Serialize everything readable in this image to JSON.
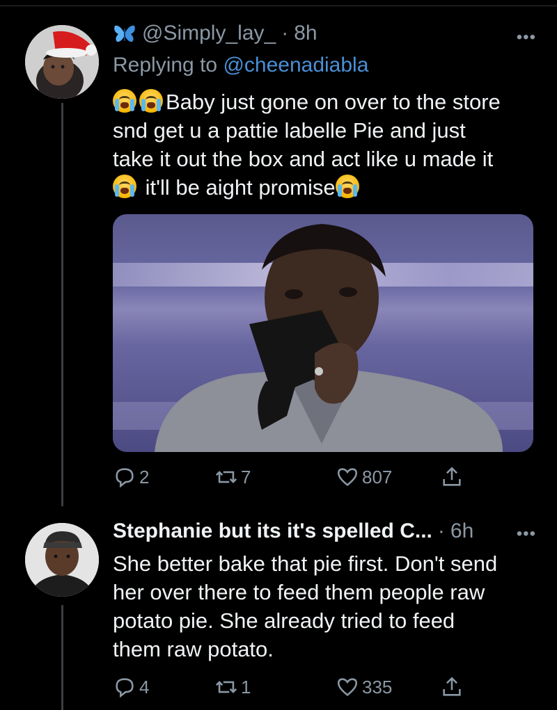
{
  "tweets": [
    {
      "handle": "@Simply_lay_",
      "separator": "·",
      "time": "8h",
      "replying_prefix": "Replying to",
      "replying_to": "@cheenadiabla",
      "text_line1": "Baby just gone on over to the store",
      "text_line2": "snd get u a pattie labelle Pie and just",
      "text_line3": "take it out the box and act like u made it",
      "text_line4": "it'll be aight promise",
      "emoji": "loudly-crying-face-emoji",
      "more": "•••",
      "stats": {
        "replies": "2",
        "retweets": "7",
        "likes": "807"
      },
      "avatar_icon": "santa-hat-avatar"
    },
    {
      "display_name": "Stephanie but its it's spelled C...",
      "separator": "·",
      "time": "6h",
      "more": "•••",
      "text_line1": "She better bake that pie first. Don't send",
      "text_line2": "her over there to feed them people raw",
      "text_line3": "potato pie. She already tried to feed",
      "text_line4": "them raw potato.",
      "stats": {
        "replies": "4",
        "retweets": "1",
        "likes": "335"
      },
      "avatar_icon": "man-portrait-avatar"
    }
  ],
  "icons": {
    "reply": "reply-icon",
    "retweet": "retweet-icon",
    "like": "heart-icon",
    "share": "share-icon",
    "verified_style": "butterfly-icon"
  },
  "colors": {
    "background": "#000000",
    "text": "#f0f3f5",
    "muted": "#8b98a5",
    "link": "#4a8fd6"
  }
}
